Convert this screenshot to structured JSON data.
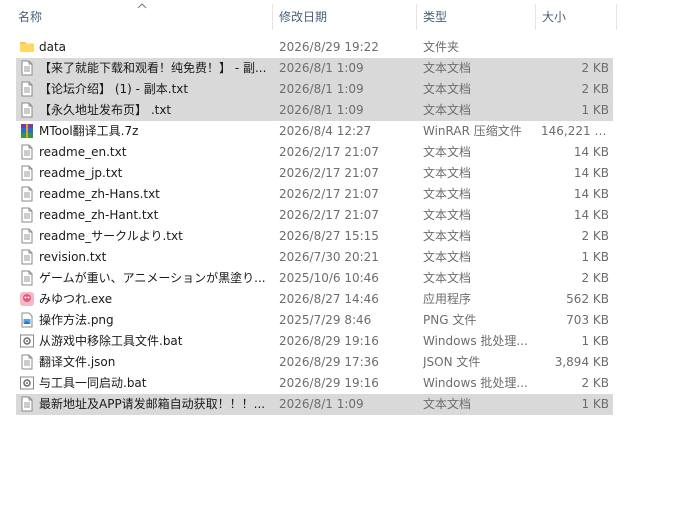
{
  "columns": {
    "name": "名称",
    "date": "修改日期",
    "type": "类型",
    "size": "大小"
  },
  "files": [
    {
      "name": "data",
      "date": "2026/8/29 19:22",
      "type": "文件夹",
      "size": "",
      "icon": "folder-icon",
      "selected": false
    },
    {
      "name": "【来了就能下载和观看！纯免费！】 - 副...",
      "date": "2026/8/1 1:09",
      "type": "文本文档",
      "size": "2 KB",
      "icon": "text-file-icon",
      "selected": true
    },
    {
      "name": "【论坛介绍】 (1) - 副本.txt",
      "date": "2026/8/1 1:09",
      "type": "文本文档",
      "size": "2 KB",
      "icon": "text-file-icon",
      "selected": true
    },
    {
      "name": "【永久地址发布页】 .txt",
      "date": "2026/8/1 1:09",
      "type": "文本文档",
      "size": "1 KB",
      "icon": "text-file-icon",
      "selected": true
    },
    {
      "name": "MTool翻译工具.7z",
      "date": "2026/8/4 12:27",
      "type": "WinRAR 压缩文件",
      "size": "146,221 KB",
      "icon": "winrar-archive-icon",
      "selected": false
    },
    {
      "name": "readme_en.txt",
      "date": "2026/2/17 21:07",
      "type": "文本文档",
      "size": "14 KB",
      "icon": "text-file-icon",
      "selected": false
    },
    {
      "name": "readme_jp.txt",
      "date": "2026/2/17 21:07",
      "type": "文本文档",
      "size": "14 KB",
      "icon": "text-file-icon",
      "selected": false
    },
    {
      "name": "readme_zh-Hans.txt",
      "date": "2026/2/17 21:07",
      "type": "文本文档",
      "size": "14 KB",
      "icon": "text-file-icon",
      "selected": false
    },
    {
      "name": "readme_zh-Hant.txt",
      "date": "2026/2/17 21:07",
      "type": "文本文档",
      "size": "14 KB",
      "icon": "text-file-icon",
      "selected": false
    },
    {
      "name": "readme_サークルより.txt",
      "date": "2026/8/27 15:15",
      "type": "文本文档",
      "size": "2 KB",
      "icon": "text-file-icon",
      "selected": false
    },
    {
      "name": "revision.txt",
      "date": "2026/7/30 20:21",
      "type": "文本文档",
      "size": "1 KB",
      "icon": "text-file-icon",
      "selected": false
    },
    {
      "name": "ゲームが重い、アニメーションが黒塗り...",
      "date": "2025/10/6 10:46",
      "type": "文本文档",
      "size": "2 KB",
      "icon": "text-file-icon",
      "selected": false
    },
    {
      "name": "みゆつれ.exe",
      "date": "2026/8/27 14:46",
      "type": "应用程序",
      "size": "562 KB",
      "icon": "app-icon",
      "selected": false
    },
    {
      "name": "操作方法.png",
      "date": "2025/7/29 8:46",
      "type": "PNG 文件",
      "size": "703 KB",
      "icon": "image-file-icon",
      "selected": false
    },
    {
      "name": "从游戏中移除工具文件.bat",
      "date": "2026/8/29 19:16",
      "type": "Windows 批处理...",
      "size": "1 KB",
      "icon": "batch-file-icon",
      "selected": false
    },
    {
      "name": "翻译文件.json",
      "date": "2026/8/29 17:36",
      "type": "JSON 文件",
      "size": "3,894 KB",
      "icon": "json-file-icon",
      "selected": false
    },
    {
      "name": "与工具一同启动.bat",
      "date": "2026/8/29 19:16",
      "type": "Windows 批处理...",
      "size": "2 KB",
      "icon": "batch-file-icon",
      "selected": false
    },
    {
      "name": "最新地址及APP请发邮箱自动获取！！！...",
      "date": "2026/8/1 1:09",
      "type": "文本文档",
      "size": "1 KB",
      "icon": "text-file-icon",
      "selected": true
    }
  ]
}
